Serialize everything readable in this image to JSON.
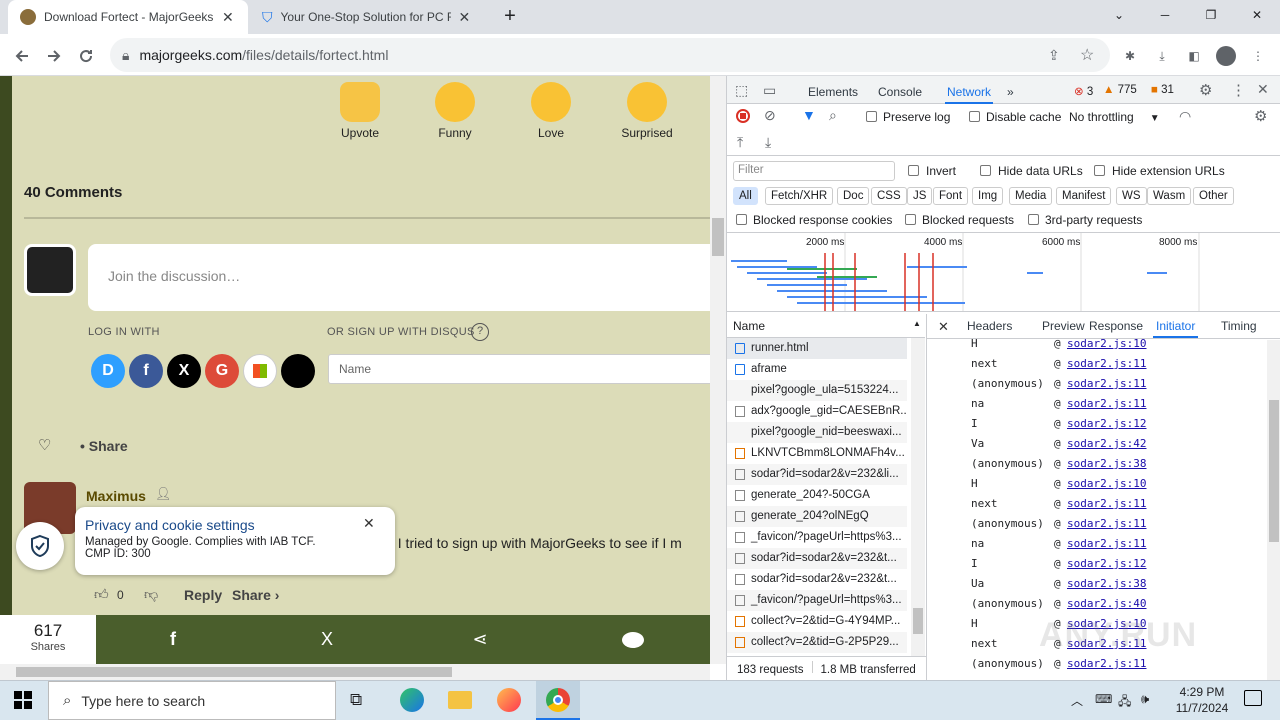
{
  "browser": {
    "tabs": [
      {
        "title": "Download Fortect - MajorGeeks"
      },
      {
        "title": "Your One-Stop Solution for PC R"
      }
    ],
    "url": {
      "domain": "majorgeeks.com",
      "path": "/files/details/fortect.html"
    }
  },
  "page": {
    "reactions": [
      {
        "label": "Upvote",
        "icon": "thumbs-up-icon"
      },
      {
        "label": "Funny",
        "icon": "tongue-out-emoji-icon"
      },
      {
        "label": "Love",
        "icon": "heart-eyes-emoji-icon"
      },
      {
        "label": "Surprised",
        "icon": "surprised-emoji-icon"
      }
    ],
    "comments_title": "40 Comments",
    "discussion_placeholder": "Join the discussion…",
    "login_with": "LOG IN WITH",
    "signup_with": "OR SIGN UP WITH DISQUS",
    "name_placeholder": "Name",
    "share_label": "Share",
    "comment": {
      "author": "Maximus",
      "text": ". I tried to sign up with MajorGeeks to see if I m",
      "votes": "0",
      "reply": "Reply",
      "share": "Share ›"
    },
    "privacy": {
      "title": "Privacy and cookie settings",
      "line1": "Managed by Google. Complies with IAB TCF.",
      "line2": "CMP ID: 300"
    },
    "shares": {
      "count": "617",
      "label": "Shares"
    }
  },
  "devtools": {
    "tabs": [
      "Elements",
      "Console",
      "Network"
    ],
    "active_tab": "Network",
    "errors": "3",
    "warnings": "775",
    "info": "31",
    "preserve_log": "Preserve log",
    "disable_cache": "Disable cache",
    "throttling": "No throttling",
    "filter_placeholder": "Filter",
    "invert": "Invert",
    "hide_data_urls": "Hide data URLs",
    "hide_ext_urls": "Hide extension URLs",
    "filter_types": [
      "All",
      "Fetch/XHR",
      "Doc",
      "CSS",
      "JS",
      "Font",
      "Img",
      "Media",
      "Manifest",
      "WS",
      "Wasm",
      "Other"
    ],
    "blocked_cookies": "Blocked response cookies",
    "blocked_requests": "Blocked requests",
    "third_party": "3rd-party requests",
    "timeline_ticks": [
      "2000 ms",
      "4000 ms",
      "6000 ms",
      "8000 ms"
    ],
    "name_header": "Name",
    "requests": [
      "runner.html",
      "aframe",
      "pixel?google_ula=5153224...",
      "adx?google_gid=CAESEBnR...",
      "pixel?google_nid=beeswaxi...",
      "LKNVTCBmm8LONMAFh4v...",
      "sodar?id=sodar2&v=232&li...",
      "generate_204?-50CGA",
      "generate_204?olNEgQ",
      "_favicon/?pageUrl=https%3...",
      "sodar?id=sodar2&v=232&t...",
      "sodar?id=sodar2&v=232&t...",
      "_favicon/?pageUrl=https%3...",
      "collect?v=2&tid=G-4Y94MP...",
      "collect?v=2&tid=G-2P5P29..."
    ],
    "detail_tabs": [
      "Headers",
      "Preview",
      "Response",
      "Initiator",
      "Timing"
    ],
    "active_detail_tab": "Initiator",
    "stack": [
      {
        "fn": "H",
        "src": "sodar2.js:10"
      },
      {
        "fn": "next",
        "src": "sodar2.js:11"
      },
      {
        "fn": "(anonymous)",
        "src": "sodar2.js:11"
      },
      {
        "fn": "na",
        "src": "sodar2.js:11"
      },
      {
        "fn": "I",
        "src": "sodar2.js:12"
      },
      {
        "fn": "Va",
        "src": "sodar2.js:42"
      },
      {
        "fn": "(anonymous)",
        "src": "sodar2.js:38"
      },
      {
        "fn": "H",
        "src": "sodar2.js:10"
      },
      {
        "fn": "next",
        "src": "sodar2.js:11"
      },
      {
        "fn": "(anonymous)",
        "src": "sodar2.js:11"
      },
      {
        "fn": "na",
        "src": "sodar2.js:11"
      },
      {
        "fn": "I",
        "src": "sodar2.js:12"
      },
      {
        "fn": "Ua",
        "src": "sodar2.js:38"
      },
      {
        "fn": "(anonymous)",
        "src": "sodar2.js:40"
      },
      {
        "fn": "H",
        "src": "sodar2.js:10"
      },
      {
        "fn": "next",
        "src": "sodar2.js:11"
      },
      {
        "fn": "(anonymous)",
        "src": "sodar2.js:11"
      }
    ],
    "requests_count": "183 requests",
    "transferred": "1.8 MB transferred",
    "watermark": "ANY.RUN"
  },
  "taskbar": {
    "search_placeholder": "Type here to search",
    "time": "4:29 PM",
    "date": "11/7/2024"
  },
  "colors": {
    "accent": "#1a73e8",
    "page_bg": "#dcdcb8",
    "share_bar": "#4a5e2c"
  }
}
